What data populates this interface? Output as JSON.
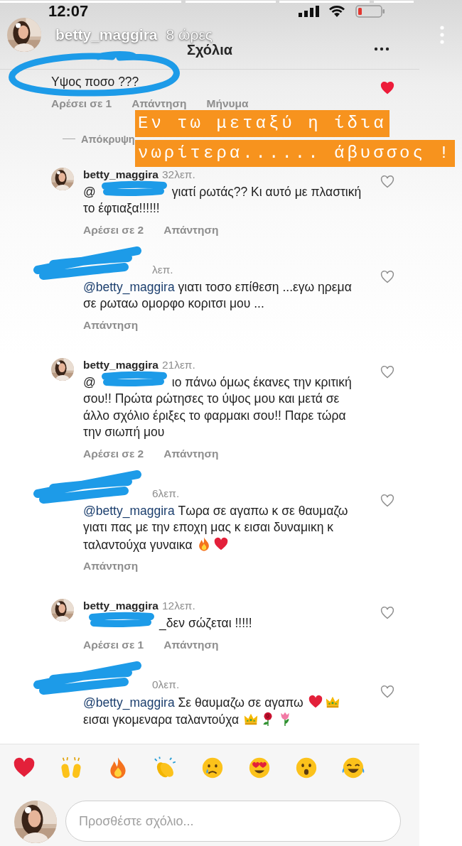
{
  "status_bar": {
    "time": "12:07"
  },
  "story": {
    "username": "betty_maggira",
    "time": "8 ώρες"
  },
  "caption": {
    "lines": [
      "Εν τω μεταξύ η ίδια",
      "νωρίτερα...... άβυσσος !"
    ]
  },
  "sheet": {
    "title": "Σχόλια"
  },
  "top_comment": {
    "text": "Υψος ποσο ???",
    "liked": true,
    "actions": [
      "Αρέσει σε 1",
      "Απάντηση",
      "Μήνυμα"
    ]
  },
  "hide_replies": "Απόκρυψη",
  "replies": [
    {
      "kind": "owner",
      "username": "betty_maggira",
      "time": "32λεπ.",
      "liked": false,
      "segments": [
        {
          "kind": "redacted",
          "text": "@"
        },
        {
          "kind": "text",
          "text": "γιατί ρωτάς?? Κι αυτό με πλαστική το έφτιαξα!!!!!!"
        }
      ],
      "actions": [
        "Αρέσει σε 2",
        "Απάντηση"
      ]
    },
    {
      "kind": "hidden",
      "time": "λεπ.",
      "liked": false,
      "segments": [
        {
          "kind": "mention",
          "text": "@betty_maggira"
        },
        {
          "kind": "text",
          "text": " γιατι τοσο επίθεση ...εγω ηρεμα σε ρωταω ομορφο κοριτσι μου ..."
        }
      ],
      "actions": [
        "Απάντηση"
      ]
    },
    {
      "kind": "owner",
      "username": "betty_maggira",
      "time": "21λεπ.",
      "liked": false,
      "segments": [
        {
          "kind": "redacted",
          "text": "@"
        },
        {
          "kind": "text",
          "text": "ιο πάνω όμως έκανες την κριτική σου!! Πρώτα ρώτησες το ύψος μου και μετά σε άλλο σχόλιο έριξες το φαρμακι σου!! Παρε τώρα την σιωπή μου"
        }
      ],
      "actions": [
        "Αρέσει σε 2",
        "Απάντηση"
      ]
    },
    {
      "kind": "hidden",
      "time": "6λεπ.",
      "liked": false,
      "segments": [
        {
          "kind": "mention",
          "text": "@betty_maggira"
        },
        {
          "kind": "text",
          "text": "  Τωρα σε αγαπω κ σε θαυμαζω γιατι πας με την εποχη μας κ εισαι δυναμικη κ ταλαντούχα γυναικα "
        },
        {
          "kind": "fire"
        },
        {
          "kind": "heart"
        }
      ],
      "actions": [
        "Απάντηση"
      ]
    },
    {
      "kind": "owner",
      "username": "betty_maggira",
      "time": "12λεπ.",
      "liked": false,
      "segments": [
        {
          "kind": "redacted"
        },
        {
          "kind": "text",
          "text": "_δεν σώζεται !!!!!"
        }
      ],
      "actions": [
        "Αρέσει σε 1",
        "Απάντηση"
      ]
    },
    {
      "kind": "hidden",
      "time": "0λεπ.",
      "liked": false,
      "segments": [
        {
          "kind": "mention",
          "text": "@betty_maggira"
        },
        {
          "kind": "text",
          "text": " Σε θαυμαζω σε αγαπω "
        },
        {
          "kind": "heart"
        },
        {
          "kind": "crown"
        },
        {
          "kind": "text",
          "text": " εισαι γκομεναρα ταλαντούχα "
        },
        {
          "kind": "crown"
        },
        {
          "kind": "rose"
        },
        {
          "kind": "tulip"
        }
      ]
    }
  ],
  "reactions": [
    {
      "kind": "heart"
    },
    {
      "kind": "raised-hands"
    },
    {
      "kind": "fire"
    },
    {
      "kind": "clap"
    },
    {
      "kind": "cry"
    },
    {
      "kind": "heart-eyes"
    },
    {
      "kind": "wow"
    },
    {
      "kind": "joy"
    }
  ],
  "composer": {
    "placeholder": "Προσθέστε σχόλιο..."
  }
}
